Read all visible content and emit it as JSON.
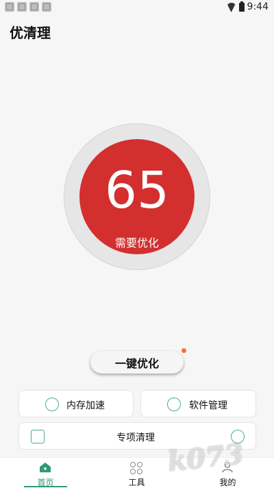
{
  "status_bar": {
    "time": "9:44",
    "left_icons": [
      "notification-icon",
      "notification-icon",
      "notification-icon",
      "notification-icon"
    ],
    "wifi_icon": "wifi-icon",
    "battery_icon": "battery-icon"
  },
  "header": {
    "title": "优清理"
  },
  "score": {
    "value": "65",
    "label": "需要优化",
    "color": "#d32f2f"
  },
  "primary_action": {
    "label": "一键优化",
    "badge_color": "#ff6b3d"
  },
  "features": [
    {
      "label": "内存加速",
      "icon": "memory-boost-icon"
    },
    {
      "label": "软件管理",
      "icon": "app-manager-icon"
    },
    {
      "label": "专项清理",
      "icon": "gallery-icon",
      "secondary_icon": "wechat-icon"
    }
  ],
  "bottom_nav": [
    {
      "label": "首页",
      "icon": "home-icon",
      "active": true
    },
    {
      "label": "工具",
      "icon": "tools-icon",
      "active": false
    },
    {
      "label": "我的",
      "icon": "profile-icon",
      "active": false
    }
  ],
  "accent_color": "#2f9a74",
  "watermark": {
    "text": "k073"
  }
}
